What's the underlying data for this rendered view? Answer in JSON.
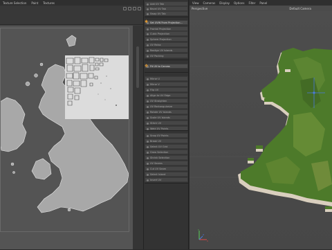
{
  "uv_editor": {
    "menu": [
      "Texture Selection",
      "Paint",
      "Textures"
    ],
    "corner_marks": [
      "1 1",
      "1 1"
    ]
  },
  "tool_panel": {
    "items": [
      {
        "label": "Add UV Tab",
        "highlighted": false
      },
      {
        "label": "Bevel UV Tab",
        "highlighted": false
      },
      {
        "label": "Swap UV Tab",
        "highlighted": false
      },
      {
        "label": "Set UVW From Projection...",
        "highlighted": true
      },
      {
        "label": "Frontal Projection",
        "highlighted": false
      },
      {
        "label": "Cubic Projection",
        "highlighted": false
      },
      {
        "label": "Sphere Projection",
        "highlighted": false
      },
      {
        "label": "UV Relax",
        "highlighted": false
      },
      {
        "label": "Realign UV Islands",
        "highlighted": false
      },
      {
        "label": "UV Packing",
        "highlighted": false
      },
      {
        "label": "Fit UV to Canvas",
        "highlighted": true
      },
      {
        "label": "Mirror U",
        "highlighted": false
      },
      {
        "label": "Mirror V",
        "highlighted": false
      },
      {
        "label": "Flip UV",
        "highlighted": false
      },
      {
        "label": "Align to UV Edge",
        "highlighted": false
      },
      {
        "label": "UV Straighten",
        "highlighted": false
      },
      {
        "label": "UV Rectangularize",
        "highlighted": false
      },
      {
        "label": "Rotate UV Islands",
        "highlighted": false
      },
      {
        "label": "Scale UV Islands",
        "highlighted": false
      },
      {
        "label": "Stitch UV",
        "highlighted": false
      },
      {
        "label": "Weld UV Points",
        "highlighted": false
      },
      {
        "label": "Snap UV Points",
        "highlighted": false
      },
      {
        "label": "Break UV",
        "highlighted": false
      },
      {
        "label": "Select UV Grid",
        "highlighted": false
      },
      {
        "label": "Grow Selection",
        "highlighted": false
      },
      {
        "label": "Shrink Selection",
        "highlighted": false
      },
      {
        "label": "UV Seams",
        "highlighted": false
      },
      {
        "label": "Cut UV Seam",
        "highlighted": false
      },
      {
        "label": "Select Island",
        "highlighted": false
      },
      {
        "label": "Invert UV",
        "highlighted": false
      }
    ]
  },
  "viewport": {
    "menu": [
      "View",
      "Cameras",
      "Display",
      "Options",
      "Filter",
      "Panel"
    ],
    "view_name": "Perspective",
    "camera_name": "Default Camera"
  },
  "colors": {
    "uv_background": "#545454",
    "uv_sheet": "#dcdcdc",
    "landmass_uv": "#a8a8a8",
    "terrain_green": "#4d7a2a",
    "cliff_edge": "#d9cfbe",
    "accent_orange": "#e59a2f"
  }
}
